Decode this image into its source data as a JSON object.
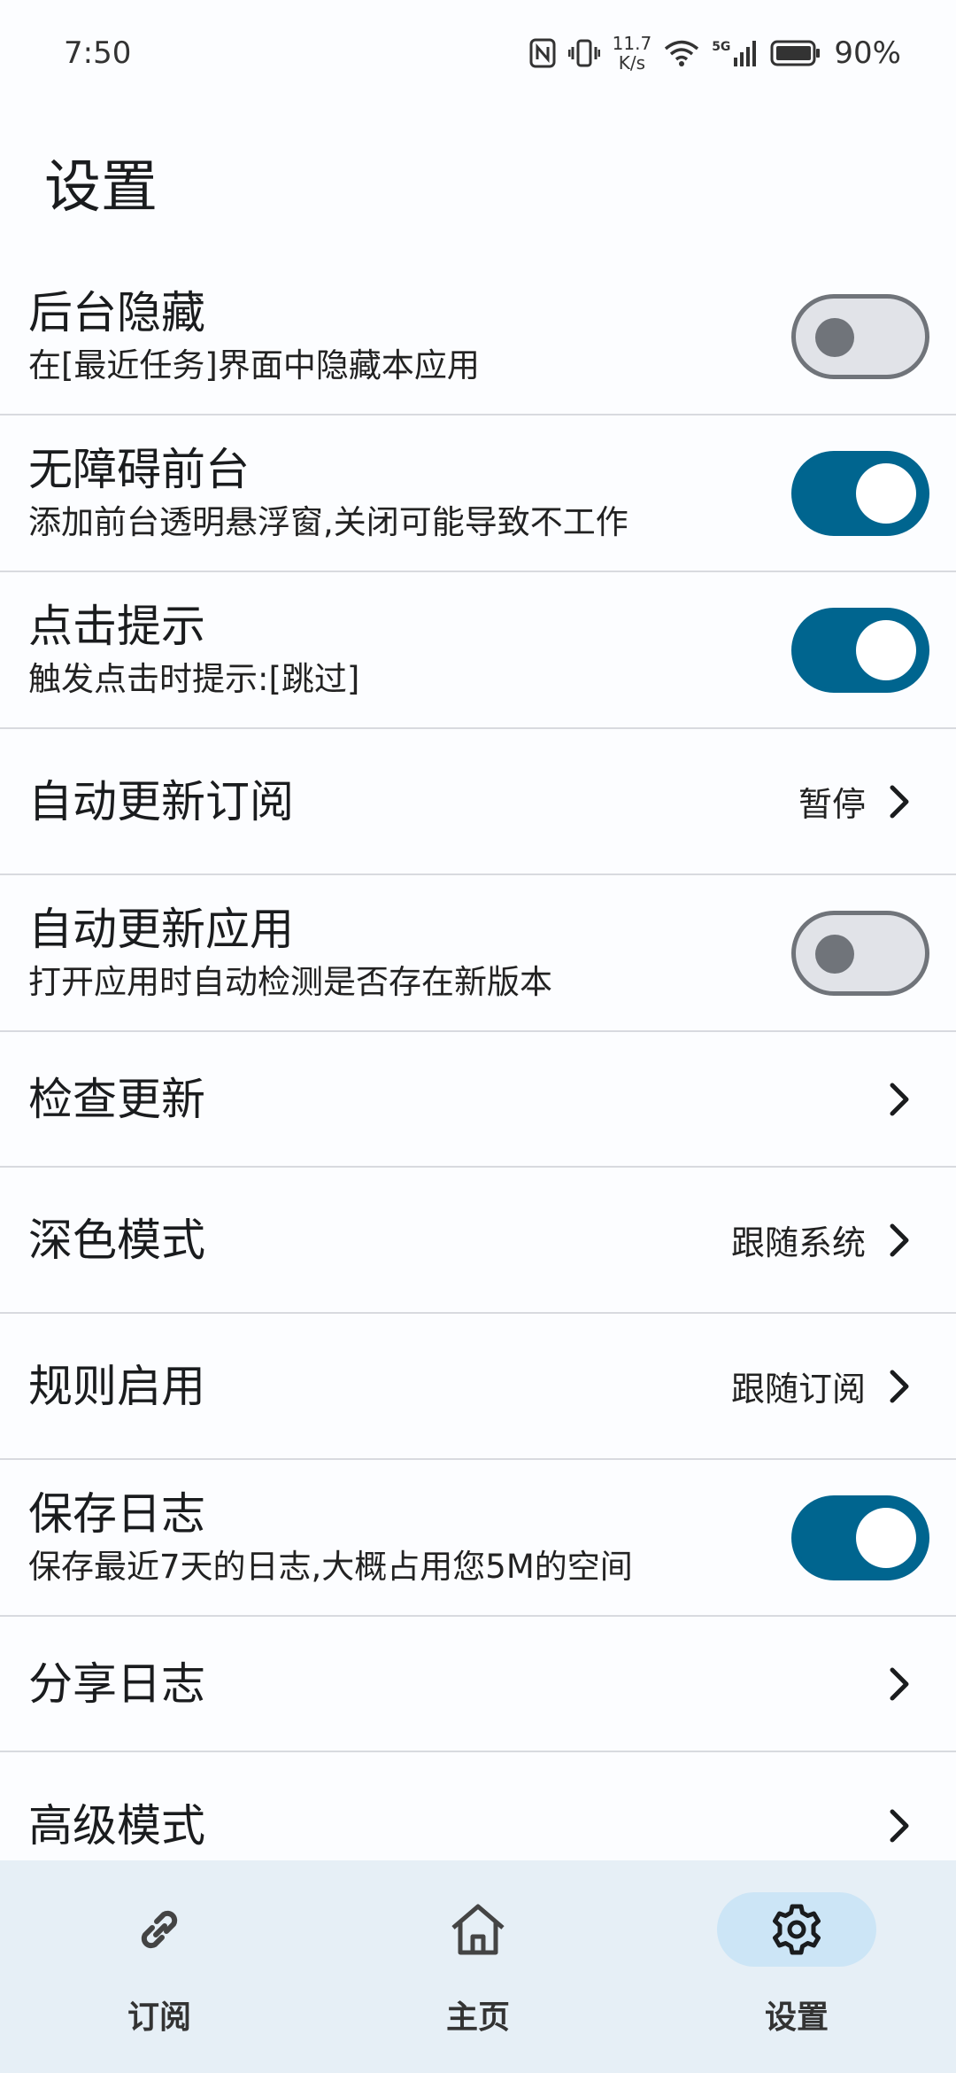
{
  "status": {
    "time": "7:50",
    "net_speed_value": "11.7",
    "net_speed_unit": "K/s",
    "network_type": "5G",
    "battery": "90%",
    "icons": [
      "nfc-icon",
      "vibrate-icon",
      "wifi-icon",
      "signal-icon",
      "battery-icon"
    ]
  },
  "page": {
    "title": "设置"
  },
  "settings": [
    {
      "title": "后台隐藏",
      "desc": "在[最近任务]界面中隐藏本应用",
      "type": "switch",
      "on": false
    },
    {
      "title": "无障碍前台",
      "desc": "添加前台透明悬浮窗,关闭可能导致不工作",
      "type": "switch",
      "on": true
    },
    {
      "title": "点击提示",
      "desc": "触发点击时提示:[跳过]",
      "type": "switch",
      "on": true
    },
    {
      "title": "自动更新订阅",
      "type": "select",
      "value": "暂停"
    },
    {
      "title": "自动更新应用",
      "desc": "打开应用时自动检测是否存在新版本",
      "type": "switch",
      "on": false
    },
    {
      "title": "检查更新",
      "type": "nav"
    },
    {
      "title": "深色模式",
      "type": "select",
      "value": "跟随系统"
    },
    {
      "title": "规则启用",
      "type": "select",
      "value": "跟随订阅"
    },
    {
      "title": "保存日志",
      "desc": "保存最近7天的日志,大概占用您5M的空间",
      "type": "switch",
      "on": true
    },
    {
      "title": "分享日志",
      "type": "nav"
    },
    {
      "title": "高级模式",
      "type": "nav"
    }
  ],
  "nav": [
    {
      "label": "订阅",
      "icon": "link-icon",
      "active": false
    },
    {
      "label": "主页",
      "icon": "home-icon",
      "active": false
    },
    {
      "label": "设置",
      "icon": "gear-icon",
      "active": true
    }
  ],
  "colors": {
    "accent": "#00658f",
    "switch_off": "#e1e3e8",
    "nav_bg": "#e6eff6",
    "nav_active": "#cce5f6"
  }
}
